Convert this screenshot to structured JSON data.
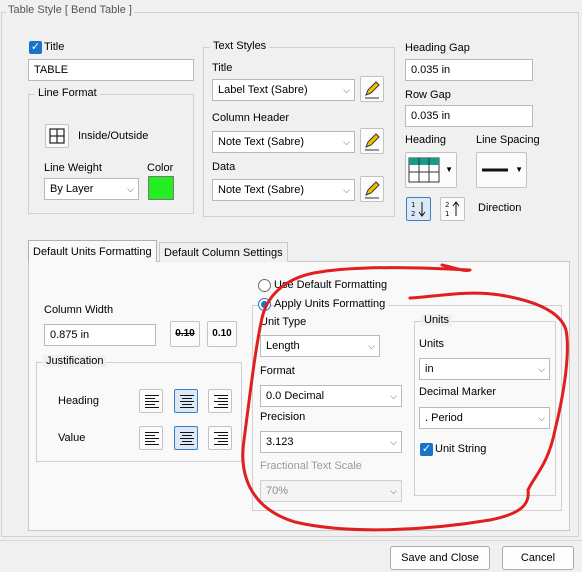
{
  "window": {
    "title": "Table Style [ Bend Table ]"
  },
  "title_section": {
    "checkbox_label": "Title",
    "checked": true,
    "value": "TABLE"
  },
  "line_format": {
    "group_label": "Line Format",
    "inside_outside_label": "Inside/Outside",
    "line_weight_label": "Line Weight",
    "line_weight_value": "By Layer",
    "color_label": "Color",
    "color_value": "#22ee22"
  },
  "text_styles": {
    "group_label": "Text Styles",
    "title_label": "Title",
    "title_value": "Label Text (Sabre)",
    "column_header_label": "Column Header",
    "column_header_value": "Note Text (Sabre)",
    "data_label": "Data",
    "data_value": "Note Text (Sabre)"
  },
  "spacing": {
    "heading_gap_label": "Heading Gap",
    "heading_gap_value": "0.035 in",
    "row_gap_label": "Row Gap",
    "row_gap_value": "0.035 in",
    "heading_label": "Heading",
    "line_spacing_label": "Line Spacing",
    "direction_label": "Direction"
  },
  "tabs": [
    {
      "label": "Default Units Formatting",
      "active": true
    },
    {
      "label": "Default Column Settings",
      "active": false
    }
  ],
  "column": {
    "width_label": "Column Width",
    "width_value": "0.875 in",
    "dec_precision_label": "0.10",
    "inc_precision_label": "0.10"
  },
  "justification": {
    "group_label": "Justification",
    "heading_label": "Heading",
    "value_label": "Value"
  },
  "units_formatting": {
    "use_default_label": "Use Default Formatting",
    "apply_label": "Apply Units Formatting",
    "selected": "apply",
    "unit_type_label": "Unit Type",
    "unit_type_value": "Length",
    "format_label": "Format",
    "format_value": "0.0 Decimal",
    "precision_label": "Precision",
    "precision_value": "3.123",
    "fractional_scale_label": "Fractional Text Scale",
    "fractional_scale_value": "70%"
  },
  "units_group": {
    "group_label": "Units",
    "units_label": "Units",
    "units_value": "in",
    "decimal_marker_label": "Decimal Marker",
    "decimal_marker_value": ". Period",
    "unit_string_label": "Unit String",
    "unit_string_checked": true
  },
  "footer": {
    "save_close_label": "Save and Close",
    "cancel_label": "Cancel"
  },
  "annotation": {
    "color": "#e02020"
  }
}
